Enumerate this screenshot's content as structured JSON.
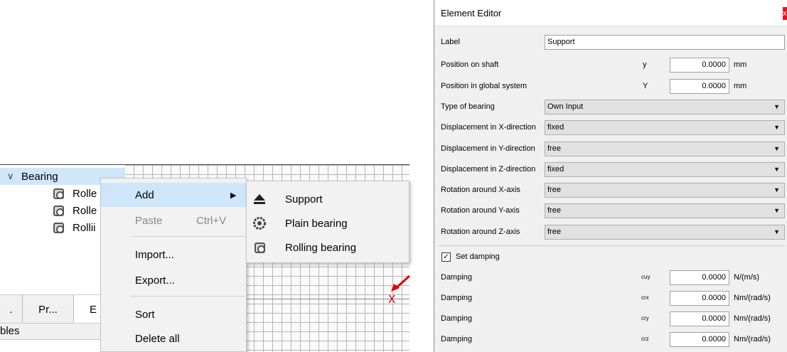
{
  "tree": {
    "parent_label": "Bearing",
    "children": [
      "Rolle",
      "Rolle",
      "Rollii"
    ]
  },
  "tabs": {
    "tab1": ".",
    "tab2": "Pr...",
    "tab3": "E"
  },
  "bottom_label": "bles",
  "grid": {
    "marker": "X",
    "marker_color": "#e00000"
  },
  "context_menu": {
    "add": "Add",
    "paste": "Paste",
    "paste_shortcut": "Ctrl+V",
    "import": "Import...",
    "export": "Export...",
    "sort": "Sort",
    "delete_all": "Delete all"
  },
  "submenu": {
    "support": "Support",
    "plain_bearing": "Plain bearing",
    "rolling_bearing": "Rolling bearing"
  },
  "editor": {
    "title": "Element Editor",
    "close": "x",
    "label": {
      "label": "Label",
      "value": "Support"
    },
    "position_on_shaft": {
      "label": "Position on shaft",
      "symbol": "y",
      "value": "0.0000",
      "unit": "mm"
    },
    "position_global": {
      "label": "Position in global system",
      "symbol": "Y",
      "value": "0.0000",
      "unit": "mm"
    },
    "type_of_bearing": {
      "label": "Type of bearing",
      "value": "Own Input"
    },
    "disp_x": {
      "label": "Displacement in X-direction",
      "value": "fixed"
    },
    "disp_y": {
      "label": "Displacement in Y-direction",
      "value": "free"
    },
    "disp_z": {
      "label": "Displacement in Z-direction",
      "value": "fixed"
    },
    "rot_x": {
      "label": "Rotation around X-axis",
      "value": "free"
    },
    "rot_y": {
      "label": "Rotation around Y-axis",
      "value": "free"
    },
    "rot_z": {
      "label": "Rotation around Z-axis",
      "value": "free"
    },
    "set_damping": {
      "label": "Set damping",
      "checked": true
    },
    "damping": [
      {
        "label": "Damping",
        "symbol": "cuy",
        "value": "0.0000",
        "unit": "N/(m/s)"
      },
      {
        "label": "Damping",
        "symbol": "crx",
        "value": "0.0000",
        "unit": "Nm/(rad/s)"
      },
      {
        "label": "Damping",
        "symbol": "cry",
        "value": "0.0000",
        "unit": "Nm/(rad/s)"
      },
      {
        "label": "Damping",
        "symbol": "crz",
        "value": "0.0000",
        "unit": "Nm/(rad/s)"
      }
    ]
  }
}
